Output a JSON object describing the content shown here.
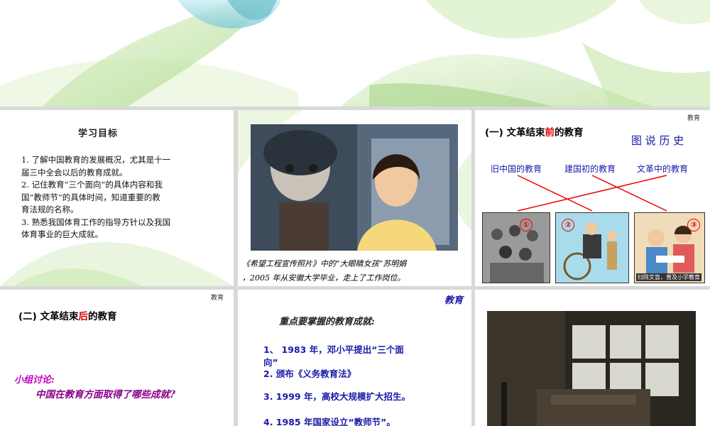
{
  "slide1": {
    "title": "学习目标",
    "objectives": [
      "1. 了解中国教育的发展概况，尤其是十一",
      "届三中全会以后的教育成就。",
      "2. 记住教育“三个面向”的具体内容和我",
      "国“教师节”的具体时间，知道重要的教",
      "育法规的名称。",
      "3. 熟悉我国体育工作的指导方针以及我国",
      "体育事业的巨大成就。"
    ]
  },
  "slide2": {
    "caption_line1": "《希望工程宣传照片》中的“大眼睛女孩”苏明娟",
    "caption_line2": "，2005 年从安徽大学毕业，走上了工作岗位。"
  },
  "slide3": {
    "corner": "教育",
    "heading_prefix": "(一) 文革结束",
    "heading_highlight": "前",
    "heading_suffix": "的教育",
    "subtitle": "图 说 历 史",
    "labels": [
      "旧中国的教育",
      "建国初的教育",
      "文革中的教育"
    ],
    "numbers": [
      "①",
      "②",
      "③"
    ],
    "panel3_text": "扫除文盲，普及小学教育"
  },
  "slide4": {
    "corner": "教育",
    "heading_prefix": "(二) 文革结束",
    "heading_highlight": "后",
    "heading_suffix": "的教育",
    "discussion_label": "小组讨论:",
    "discussion_question": "中国在教育方面取得了哪些成就?"
  },
  "slide5": {
    "corner": "教育",
    "heading": "重点要掌握的教育成就:",
    "items": [
      "1、 1983 年，邓小平提出“三个面",
      "向”",
      "2.  颁布《义务教育法》",
      "3. 1999 年，高校大规模扩大招生。",
      "4. 1985 年国家设立“教师节”。"
    ]
  },
  "colors": {
    "accent_red": "#e00000",
    "accent_blue": "#1a1aa8",
    "banner_green": "#a8d88a"
  }
}
